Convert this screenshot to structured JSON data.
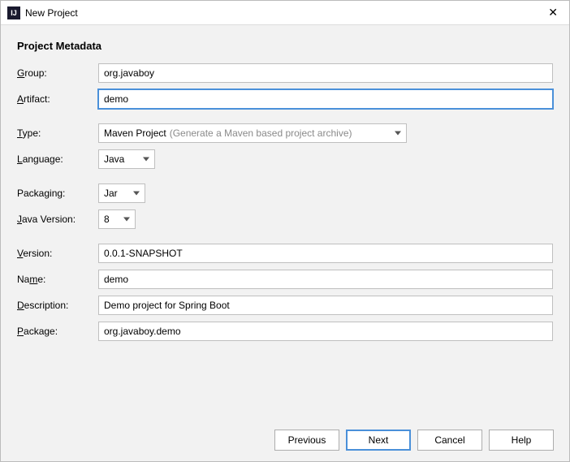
{
  "titlebar": {
    "app_icon_text": "IJ",
    "title": "New Project",
    "close_glyph": "✕"
  },
  "heading": "Project Metadata",
  "labels": {
    "group_pre": "G",
    "group_post": "roup:",
    "artifact_pre": "A",
    "artifact_post": "rtifact:",
    "type_pre": "T",
    "type_post": "ype:",
    "language_pre": "L",
    "language_post": "anguage:",
    "packaging": "Packaging:",
    "javaver_pre": "J",
    "javaver_post": "ava Version:",
    "version_pre": "V",
    "version_post": "ersion:",
    "name_a": "Na",
    "name_u": "m",
    "name_b": "e:",
    "description_pre": "D",
    "description_post": "escription:",
    "package_pre": "P",
    "package_post": "ackage:"
  },
  "fields": {
    "group": "org.javaboy",
    "artifact": "demo",
    "type_value": "Maven Project",
    "type_hint": "(Generate a Maven based project archive)",
    "language": "Java",
    "packaging": "Jar",
    "java_version": "8",
    "version": "0.0.1-SNAPSHOT",
    "name": "demo",
    "description": "Demo project for Spring Boot",
    "package": "org.javaboy.demo"
  },
  "buttons": {
    "previous": "Previous",
    "next": "Next",
    "cancel": "Cancel",
    "help": "Help"
  }
}
